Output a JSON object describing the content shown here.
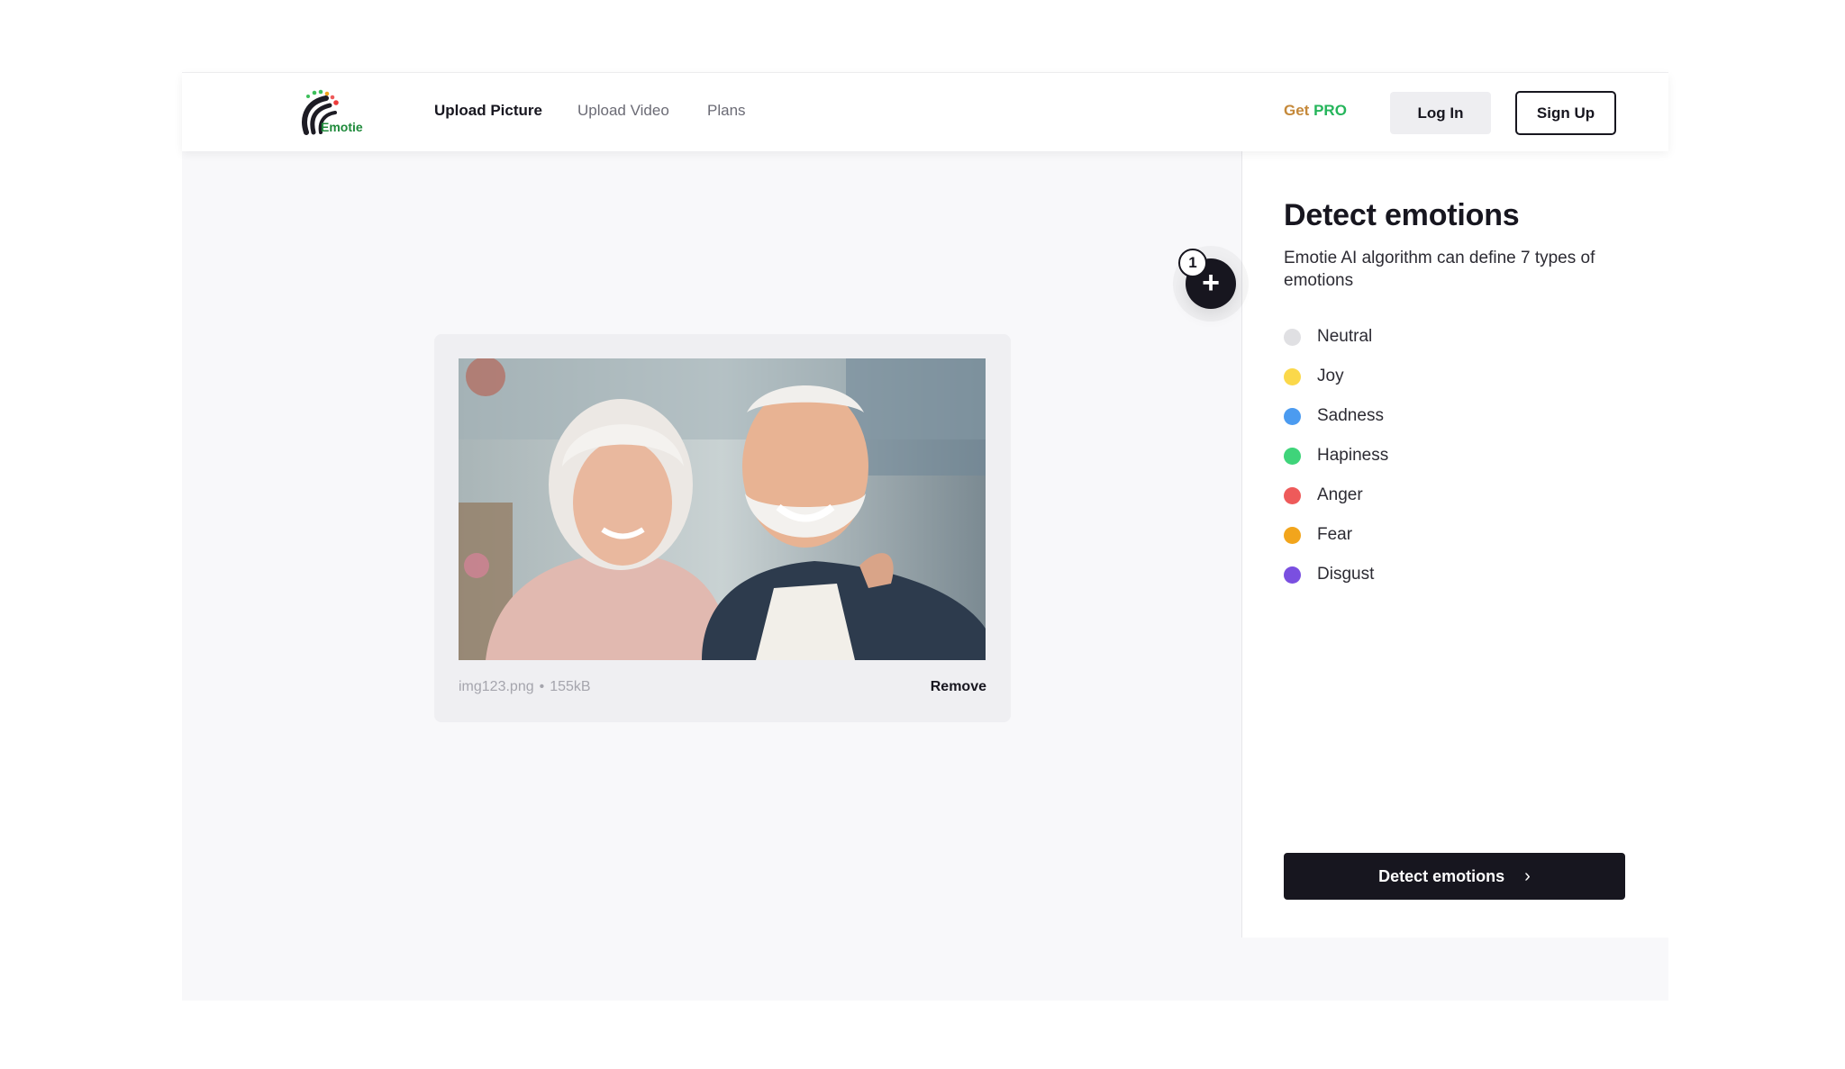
{
  "brand": {
    "name": "Emotie",
    "logo_icon": "emotie-logo-icon"
  },
  "nav": {
    "links": [
      {
        "label": "Upload Picture",
        "active": true
      },
      {
        "label": "Upload Video",
        "active": false
      },
      {
        "label": "Plans",
        "active": false
      }
    ],
    "get_pro": {
      "prefix": "Get",
      "suffix": "PRO"
    },
    "login_label": "Log In",
    "signup_label": "Sign Up"
  },
  "upload": {
    "file_name": "img123.png",
    "separator": "•",
    "file_size": "155kB",
    "remove_label": "Remove"
  },
  "add_button": {
    "icon": "plus-icon",
    "step_number": "1"
  },
  "panel": {
    "title": "Detect emotions",
    "description": "Emotie AI algorithm can define 7 types of emotions",
    "emotions": [
      {
        "label": "Neutral",
        "color": "#e0e0e3"
      },
      {
        "label": "Joy",
        "color": "#fbd84a"
      },
      {
        "label": "Sadness",
        "color": "#4b9bf0"
      },
      {
        "label": "Hapiness",
        "color": "#3fd47a"
      },
      {
        "label": "Anger",
        "color": "#ee5a5a"
      },
      {
        "label": "Fear",
        "color": "#f2a51c"
      },
      {
        "label": "Disgust",
        "color": "#7a4fe0"
      }
    ],
    "detect_button_label": "Detect emotions",
    "detect_button_icon": "chevron-right-icon"
  },
  "colors": {
    "dark": "#17161f",
    "accent_orange": "#c5893a",
    "accent_green": "#25b55b"
  }
}
